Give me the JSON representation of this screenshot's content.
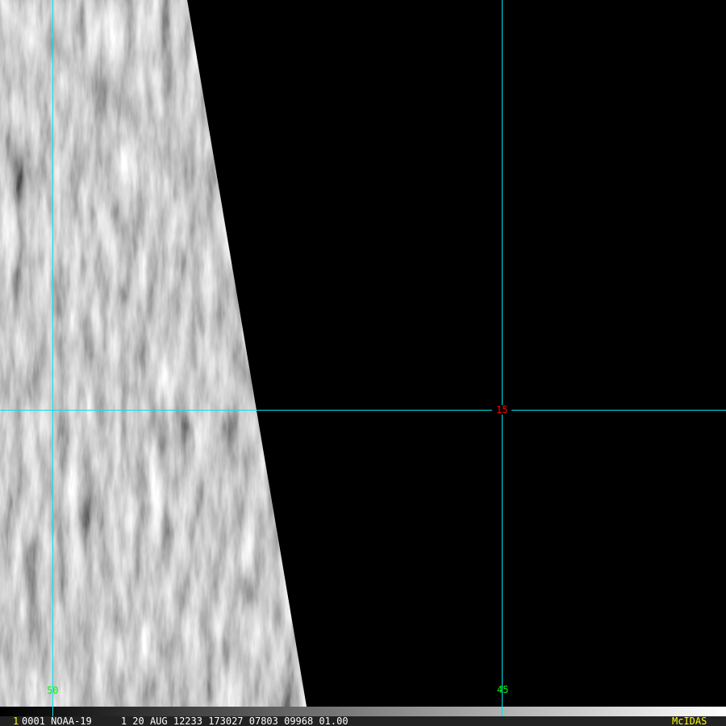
{
  "labels": {
    "lon_left": "50",
    "lon_right": "45",
    "lat": "15"
  },
  "status": {
    "frame_number": "1",
    "info": "0001 NOAA-19     1 20 AUG 12233 173027 07803 09968 01.00",
    "brand": "McIDAS"
  },
  "colors": {
    "grid": "#00e5ee",
    "lon_label": "#00ff00",
    "lat_label": "#ff0000",
    "brand": "#ffff00"
  }
}
